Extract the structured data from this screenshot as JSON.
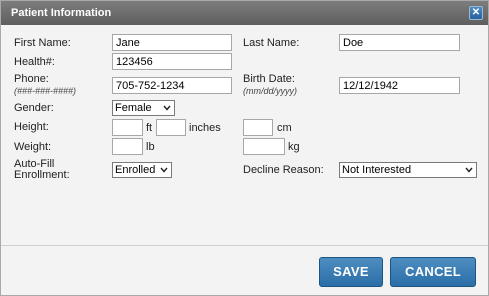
{
  "dialog": {
    "title": "Patient Information"
  },
  "form": {
    "first_name": {
      "label": "First Name:",
      "value": "Jane"
    },
    "last_name": {
      "label": "Last Name:",
      "value": "Doe"
    },
    "health_num": {
      "label": "Health#:",
      "value": "123456"
    },
    "phone": {
      "label": "Phone:",
      "hint": "(###-###-####)",
      "value": "705-752-1234"
    },
    "birth_date": {
      "label": "Birth Date:",
      "hint": "(mm/dd/yyyy)",
      "value": "12/12/1942"
    },
    "gender": {
      "label": "Gender:",
      "value": "Female"
    },
    "height": {
      "label": "Height:",
      "ft_unit": "ft",
      "inches_unit": "inches",
      "cm_unit": "cm",
      "ft_value": "",
      "inches_value": "",
      "cm_value": ""
    },
    "weight": {
      "label": "Weight:",
      "lb_unit": "lb",
      "kg_unit": "kg",
      "lb_value": "",
      "kg_value": ""
    },
    "auto_fill": {
      "label_line1": "Auto-Fill",
      "label_line2": "Enrollment:",
      "value": "Enrolled"
    },
    "decline_reason": {
      "label": "Decline Reason:",
      "value": "Not Interested"
    }
  },
  "buttons": {
    "save": "SAVE",
    "cancel": "CANCEL"
  },
  "icons": {
    "close": "close-icon",
    "dropdown": "chevron-down-icon"
  }
}
